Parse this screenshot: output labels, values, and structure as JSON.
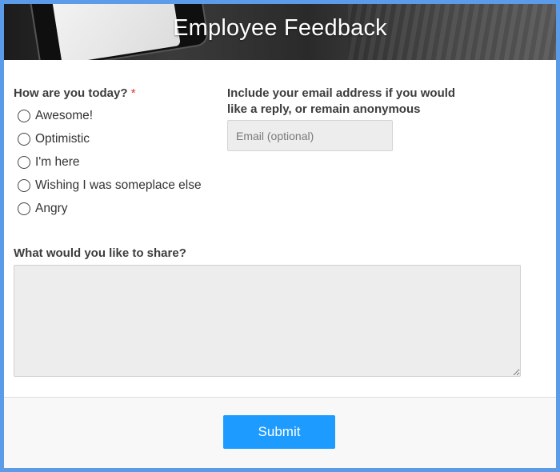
{
  "header": {
    "title": "Employee Feedback"
  },
  "mood_question": {
    "label": "How are you today?",
    "required_marker": "*",
    "options": [
      {
        "label": "Awesome!"
      },
      {
        "label": "Optimistic"
      },
      {
        "label": "I'm here"
      },
      {
        "label": "Wishing I was someplace else"
      },
      {
        "label": "Angry"
      }
    ]
  },
  "email_question": {
    "label_line1": "Include your email address if you would",
    "label_line2": "like a reply, or remain anonymous",
    "placeholder": "Email (optional)",
    "value": ""
  },
  "share_question": {
    "label": "What would you like to share?",
    "value": ""
  },
  "footer": {
    "submit_label": "Submit"
  },
  "colors": {
    "frame_border": "#5b9be8",
    "submit_button": "#1e9bff",
    "required": "#e0322e",
    "input_background": "#ededed"
  }
}
